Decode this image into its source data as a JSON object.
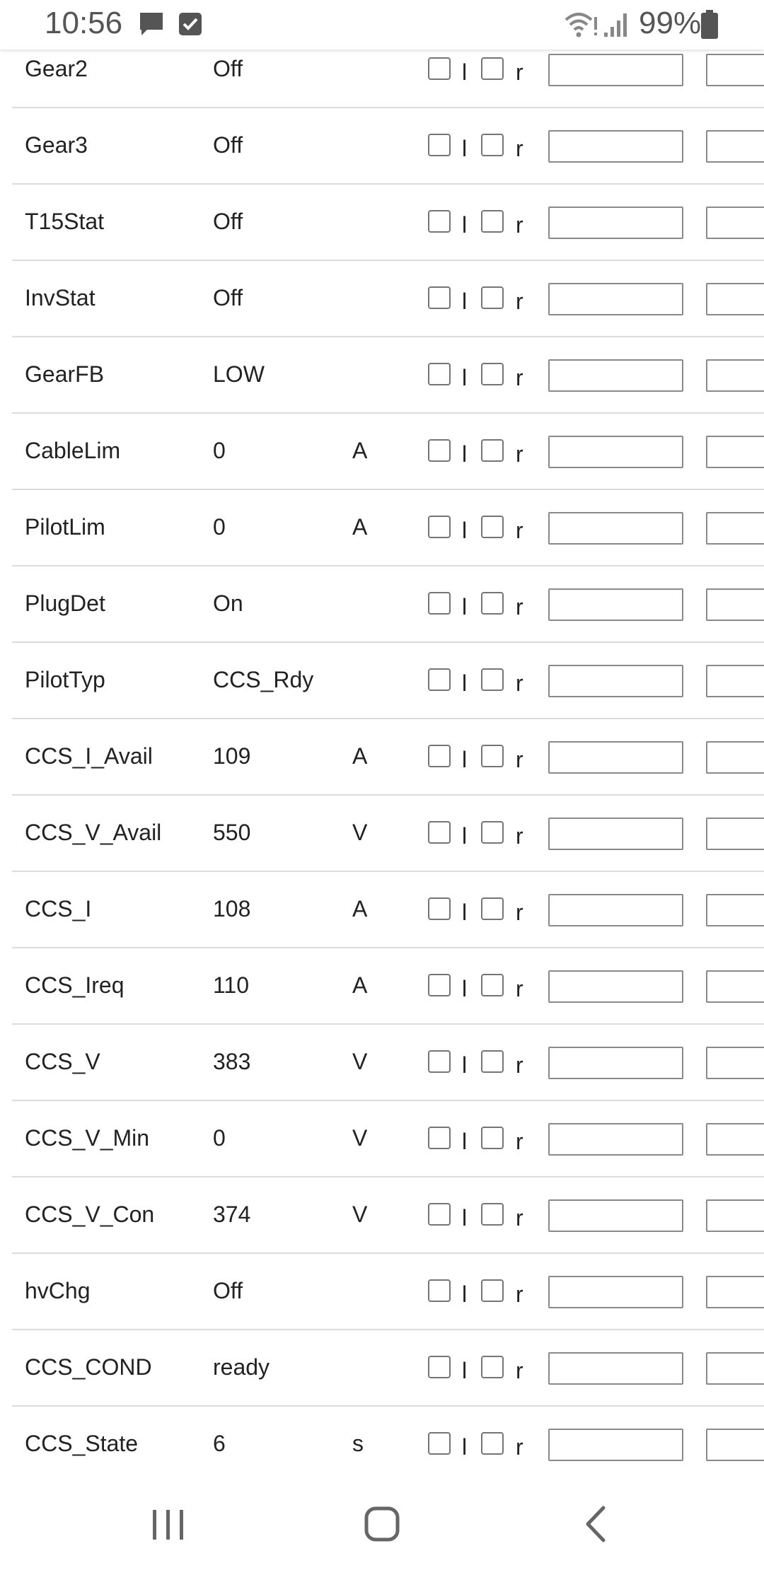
{
  "status_bar": {
    "time": "10:56",
    "battery": "99%"
  },
  "checkbox_labels": {
    "first": "l",
    "second": "r"
  },
  "rows": [
    {
      "name": "Gear2",
      "value": "Off",
      "unit": ""
    },
    {
      "name": "Gear3",
      "value": "Off",
      "unit": ""
    },
    {
      "name": "T15Stat",
      "value": "Off",
      "unit": ""
    },
    {
      "name": "InvStat",
      "value": "Off",
      "unit": ""
    },
    {
      "name": "GearFB",
      "value": "LOW",
      "unit": ""
    },
    {
      "name": "CableLim",
      "value": "0",
      "unit": "A"
    },
    {
      "name": "PilotLim",
      "value": "0",
      "unit": "A"
    },
    {
      "name": "PlugDet",
      "value": "On",
      "unit": ""
    },
    {
      "name": "PilotTyp",
      "value": "CCS_Rdy",
      "unit": ""
    },
    {
      "name": "CCS_I_Avail",
      "value": "109",
      "unit": "A"
    },
    {
      "name": "CCS_V_Avail",
      "value": "550",
      "unit": "V"
    },
    {
      "name": "CCS_I",
      "value": "108",
      "unit": "A"
    },
    {
      "name": "CCS_Ireq",
      "value": "110",
      "unit": "A"
    },
    {
      "name": "CCS_V",
      "value": "383",
      "unit": "V"
    },
    {
      "name": "CCS_V_Min",
      "value": "0",
      "unit": "V"
    },
    {
      "name": "CCS_V_Con",
      "value": "374",
      "unit": "V"
    },
    {
      "name": "hvChg",
      "value": "Off",
      "unit": ""
    },
    {
      "name": "CCS_COND",
      "value": "ready",
      "unit": ""
    },
    {
      "name": "CCS_State",
      "value": "6",
      "unit": "s"
    }
  ],
  "nav_bar": {
    "recents_icon": "recents-icon",
    "home_icon": "home-icon",
    "back_icon": "back-icon"
  }
}
